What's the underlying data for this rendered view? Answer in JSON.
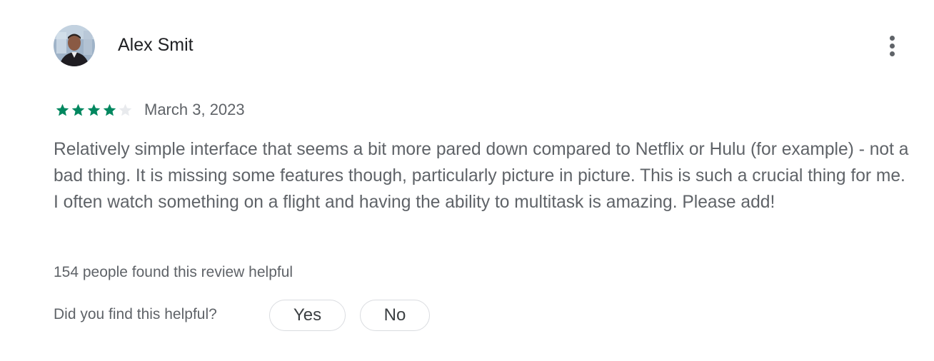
{
  "review": {
    "author": {
      "name": "Alex Smit",
      "avatar": "user-photo-avatar"
    },
    "menu_icon": "more-vert-icon",
    "rating": {
      "value": 4,
      "max": 5,
      "filled_color": "#01875f",
      "empty_color": "#e8eaed"
    },
    "date": "March 3, 2023",
    "text": "Relatively simple interface that seems a bit more pared down compared to Netflix or Hulu (for example) - not a bad thing. It is missing some features though, particularly picture in picture. This is such a crucial thing for me. I often watch something on a flight and having the ability to multitask is amazing. Please add!",
    "helpful_count_text": "154 people found this review helpful",
    "helpful_question": "Did you find this helpful?",
    "buttons": {
      "yes_label": "Yes",
      "no_label": "No"
    }
  }
}
